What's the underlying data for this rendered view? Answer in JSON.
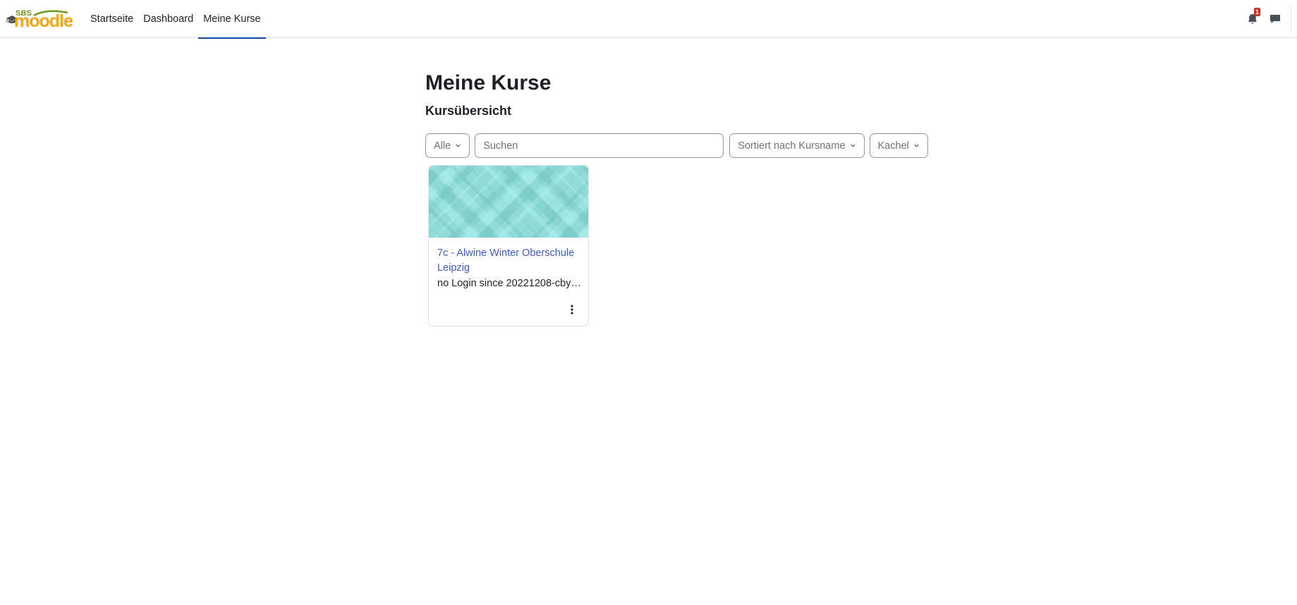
{
  "logo": {
    "top_text": "SBS",
    "main_text": "moodle"
  },
  "nav": {
    "items": [
      {
        "label": "Startseite",
        "active": false
      },
      {
        "label": "Dashboard",
        "active": false
      },
      {
        "label": "Meine Kurse",
        "active": true
      }
    ],
    "notifications": {
      "icon": "bell-icon",
      "count": "1"
    },
    "messages": {
      "icon": "message-icon"
    }
  },
  "page": {
    "title": "Meine Kurse",
    "section_title": "Kursübersicht"
  },
  "filters": {
    "grouping": "Alle",
    "search_placeholder": "Suchen",
    "sort": "Sortiert nach Kursname",
    "view": "Kachel"
  },
  "courses": [
    {
      "name": "7c - Alwine Winter Oberschule Leipzig",
      "category": "no Login since 20221208-cbyva..."
    }
  ],
  "colors": {
    "accent": "#0f47ad",
    "link": "#3d5bc7",
    "badge": "#ca3120",
    "card_pattern": "#8fd9d6"
  }
}
